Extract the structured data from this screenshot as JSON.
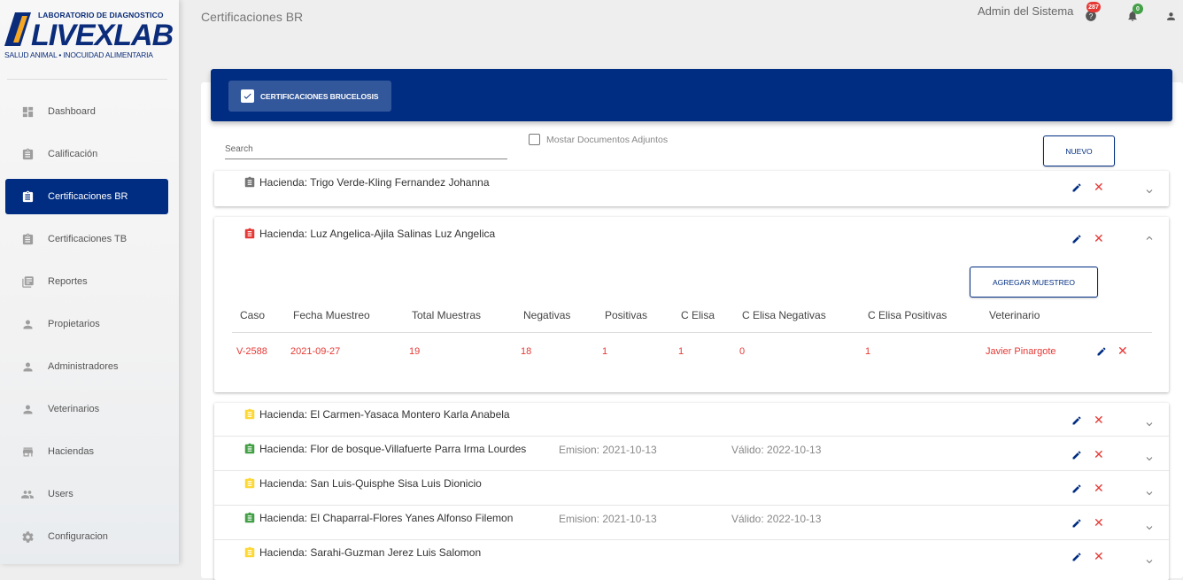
{
  "sidebar": {
    "logo": {
      "top": "LABORATORIO DE DIAGNOSTICO",
      "main": "LIVEXLAB",
      "bottom": "SALUD ANIMAL • INOCUIDAD ALIMENTARIA"
    },
    "items": [
      {
        "label": "Dashboard",
        "icon": "dashboard-icon"
      },
      {
        "label": "Calificación",
        "icon": "clipboard-icon"
      },
      {
        "label": "Certificaciones BR",
        "icon": "clipboard-icon"
      },
      {
        "label": "Certificaciones TB",
        "icon": "clipboard-icon"
      },
      {
        "label": "Reportes",
        "icon": "library-books-icon"
      },
      {
        "label": "Propietarios",
        "icon": "person-icon"
      },
      {
        "label": "Administradores",
        "icon": "person-icon"
      },
      {
        "label": "Veterinarios",
        "icon": "person-icon"
      },
      {
        "label": "Haciendas",
        "icon": "store-icon"
      },
      {
        "label": "Users",
        "icon": "people-icon"
      },
      {
        "label": "Configuracion",
        "icon": "gear-icon"
      }
    ]
  },
  "topbar": {
    "title": "Certificaciones BR",
    "user": "Admin del Sistema",
    "help_badge": "287",
    "notif_badge": "0"
  },
  "header": {
    "tab_label": "CERTIFICACIONES BRUCELOSIS"
  },
  "toolbar": {
    "search_placeholder": "Search",
    "attach_label": "Mostar Documentos Adjuntos",
    "new_button": "NUEVO"
  },
  "expanded": {
    "add_button": "AGREGAR MUESTREO",
    "columns": [
      "Caso",
      "Fecha Muestreo",
      "Total Muestras",
      "Negativas",
      "Positivas",
      "C Elisa",
      "C Elisa Negativas",
      "C Elisa Positivas",
      "Veterinario"
    ],
    "row": [
      "V-2588",
      "2021-09-27",
      "19",
      "18",
      "1",
      "1",
      "0",
      "1",
      "Javier Pinargote"
    ]
  },
  "haciendas": [
    {
      "title": "Hacienda: Trigo Verde-Kling Fernandez Johanna",
      "status": "gray",
      "emision": "",
      "valido": ""
    },
    {
      "title": "Hacienda: Luz Angelica-Ajila Salinas Luz Angelica",
      "status": "red",
      "emision": "",
      "valido": ""
    },
    {
      "title": "Hacienda: El Carmen-Yasaca Montero Karla Anabela",
      "status": "yellow",
      "emision": "",
      "valido": ""
    },
    {
      "title": "Hacienda: Flor de bosque-Villafuerte Parra Irma Lourdes",
      "status": "green",
      "emision": "Emision: 2021-10-13",
      "valido": "Válido: 2022-10-13"
    },
    {
      "title": "Hacienda: San Luis-Quisphe Sisa Luis Dionicio",
      "status": "yellow",
      "emision": "",
      "valido": ""
    },
    {
      "title": "Hacienda: El Chaparral-Flores Yanes Alfonso Filemon",
      "status": "green",
      "emision": "Emision: 2021-10-13",
      "valido": "Válido: 2022-10-13"
    },
    {
      "title": "Hacienda: Sarahi-Guzman Jerez Luis Salomon",
      "status": "yellow",
      "emision": "",
      "valido": ""
    }
  ],
  "colors": {
    "primary": "#002d82",
    "danger": "#e53935",
    "gray": "#757575",
    "red": "#e53935",
    "yellow": "#fdd835",
    "green": "#43a047"
  }
}
